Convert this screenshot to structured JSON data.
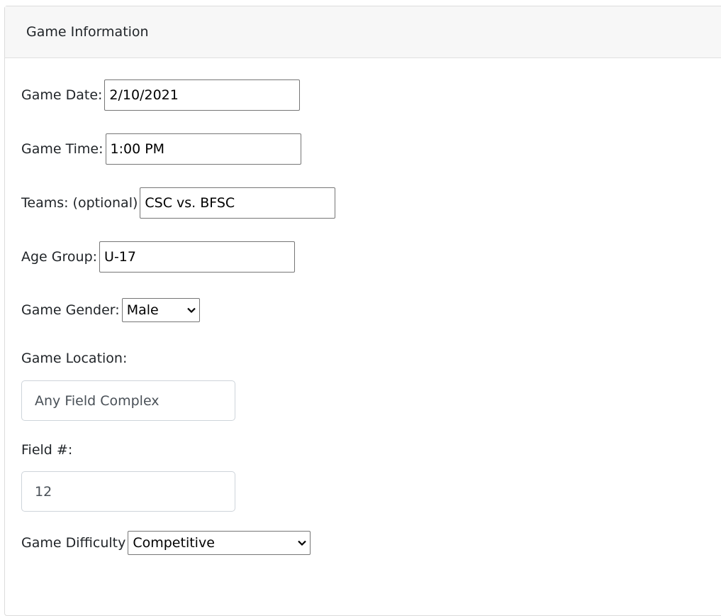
{
  "card": {
    "title": "Game Information"
  },
  "fields": {
    "game_date": {
      "label": "Game Date:",
      "value": "2/10/2021"
    },
    "game_time": {
      "label": "Game Time:",
      "value": "1:00 PM"
    },
    "teams": {
      "label": "Teams: (optional)",
      "value": "CSC vs. BFSC"
    },
    "age_group": {
      "label": "Age Group:",
      "value": "U-17"
    },
    "game_gender": {
      "label": "Game Gender:",
      "value": "Male"
    },
    "game_location": {
      "label": "Game Location:",
      "value": "Any Field Complex"
    },
    "field_number": {
      "label": "Field #:",
      "value": "12"
    },
    "game_difficulty": {
      "label": "Game Difficulty",
      "value": "Competitive"
    }
  },
  "icons": {
    "select_arrow": "chevron-down-icon"
  }
}
